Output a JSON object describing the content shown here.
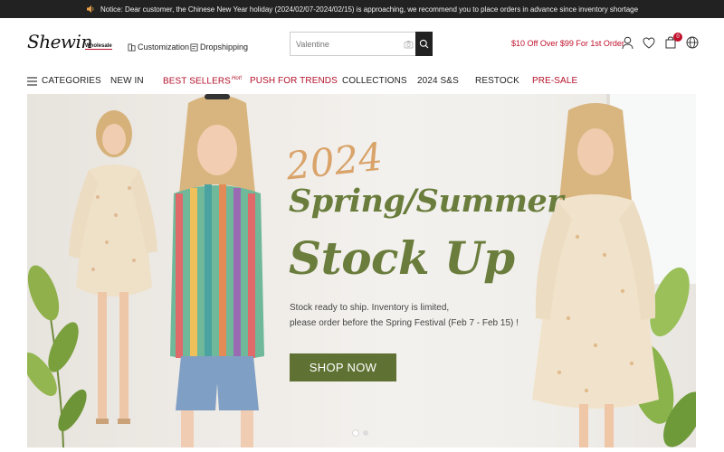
{
  "notice": {
    "text": "Notice: Dear customer, the Chinese New Year holiday (2024/02/07-2024/02/15) is approaching, we recommend you to place orders in advance since inventory shortage",
    "icon": "speaker-icon"
  },
  "header": {
    "logo_script": "Shewin",
    "logo_sub": "Wholesale",
    "links": [
      {
        "label": "Customization",
        "icon": "customization-icon"
      },
      {
        "label": "Dropshipping",
        "icon": "dropshipping-icon"
      }
    ],
    "search": {
      "placeholder": "Valentine"
    },
    "promo": "$10 Off Over $99 For 1st Order",
    "cart_count": "0"
  },
  "nav": {
    "categories": "CATEGORIES",
    "items": [
      {
        "label": "NEW IN"
      },
      {
        "label": "BEST SELLERS",
        "tag": "Hot!"
      },
      {
        "label": "PUSH FOR TRENDS"
      },
      {
        "label": "COLLECTIONS"
      },
      {
        "label": "2024 S&S"
      },
      {
        "label": "RESTOCK"
      },
      {
        "label": "PRE-SALE"
      }
    ]
  },
  "banner": {
    "script": "2024",
    "headline1": "Spring/Summer",
    "headline2": "Stock Up",
    "desc_line1": "Stock ready to ship. Inventory is limited,",
    "desc_line2": "please order before the Spring Festival (Feb 7 - Feb 15) !",
    "cta": "SHOP NOW",
    "slides": 2,
    "active_slide": 1
  },
  "colors": {
    "accent_red": "#c0102b",
    "olive": "#6a7d3c",
    "cta_bg": "#5f7233",
    "notice_bg": "#222222"
  }
}
